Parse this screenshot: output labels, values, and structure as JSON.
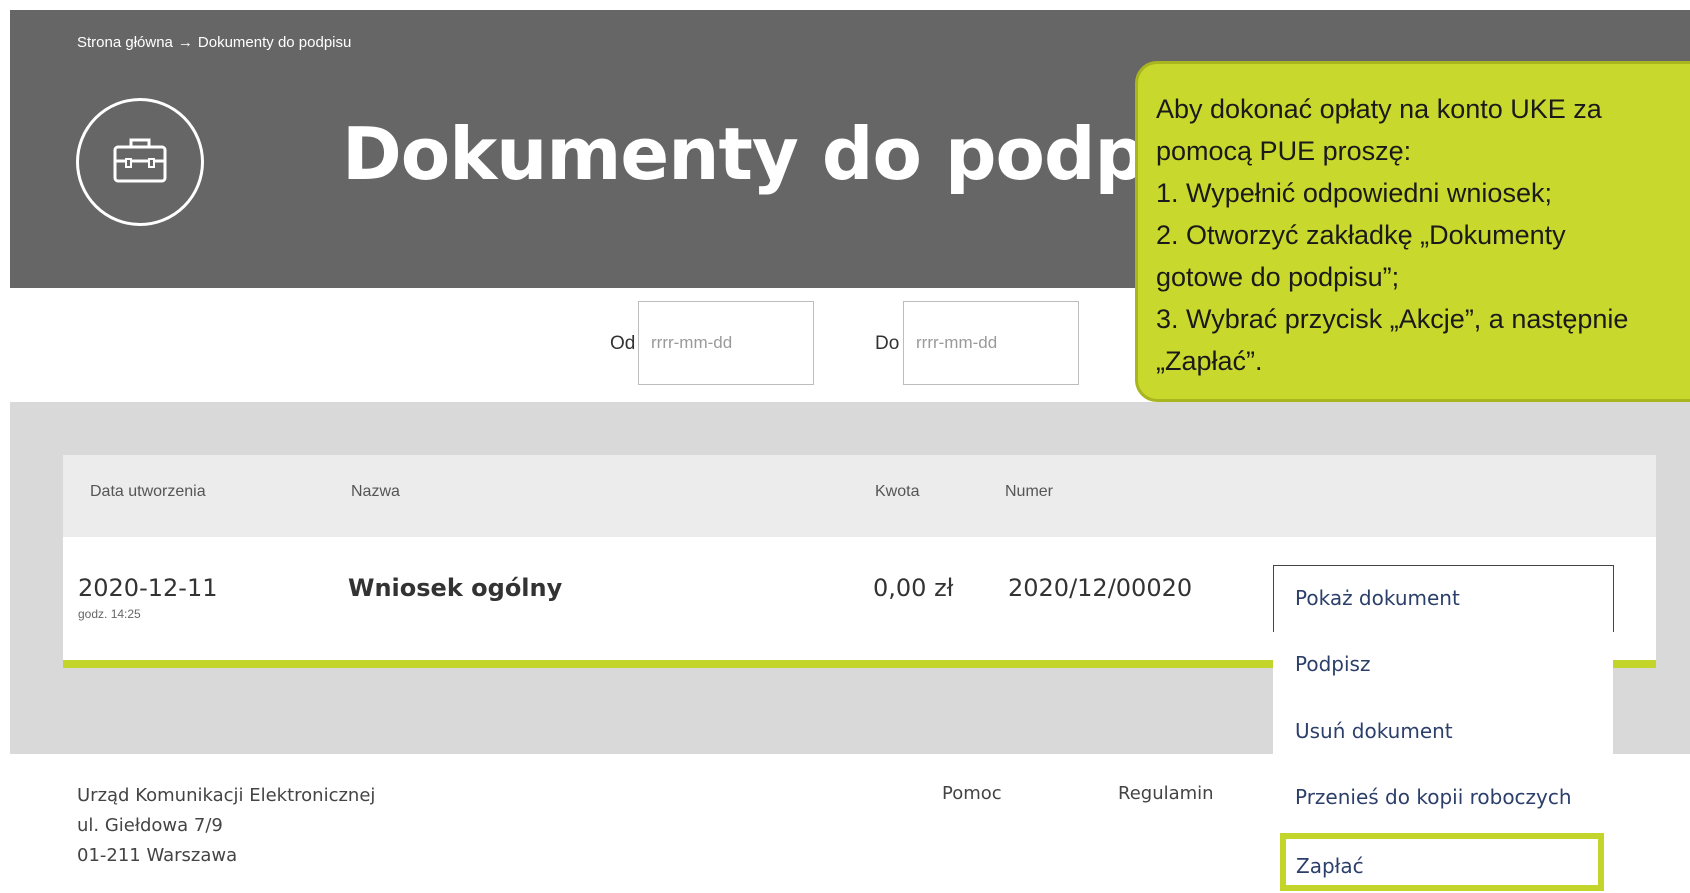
{
  "breadcrumb": {
    "home": "Strona główna",
    "separator": "→",
    "current": "Dokumenty do podpisu"
  },
  "page_title": "Dokumenty do podpisu",
  "icons": {
    "logo": "briefcase-icon",
    "breadcrumb_separator": "arrow-right-icon"
  },
  "filters": {
    "from_label": "Od",
    "from_placeholder": "rrrr-mm-dd",
    "to_label": "Do",
    "to_placeholder": "rrrr-mm-dd"
  },
  "table": {
    "headers": {
      "date": "Data utworzenia",
      "name": "Nazwa",
      "amount": "Kwota",
      "number": "Numer"
    },
    "row": {
      "date": "2020-12-11",
      "time": "godz. 14:25",
      "name": "Wniosek ogólny",
      "amount": "0,00 zł",
      "number": "2020/12/00020"
    }
  },
  "actions_menu": {
    "show": "Pokaż dokument",
    "sign": "Podpisz",
    "delete": "Usuń dokument",
    "move_to_drafts": "Przenieś do kopii roboczych",
    "pay": "Zapłać"
  },
  "footer": {
    "org": "Urząd Komunikacji Elektronicznej",
    "street": "ul. Giełdowa 7/9",
    "city": "01-211 Warszawa",
    "help": "Pomoc",
    "terms": "Regulamin"
  },
  "tooltip": {
    "line1": "Aby dokonać opłaty na konto UKE za",
    "line2": "pomocą PUE proszę:",
    "line3": "1. Wypełnić odpowiedni wniosek;",
    "line4": "2. Otworzyć zakładkę „Dokumenty",
    "line5": "gotowe do podpisu”;",
    "line6": "3. Wybrać przycisk „Akcje”, a następnie",
    "line7": "„Zapłać”."
  },
  "colors": {
    "header_bg": "#666666",
    "accent": "#c3d42a",
    "tooltip_bg": "#c9d82c",
    "menu_text": "#2b3f6a"
  }
}
